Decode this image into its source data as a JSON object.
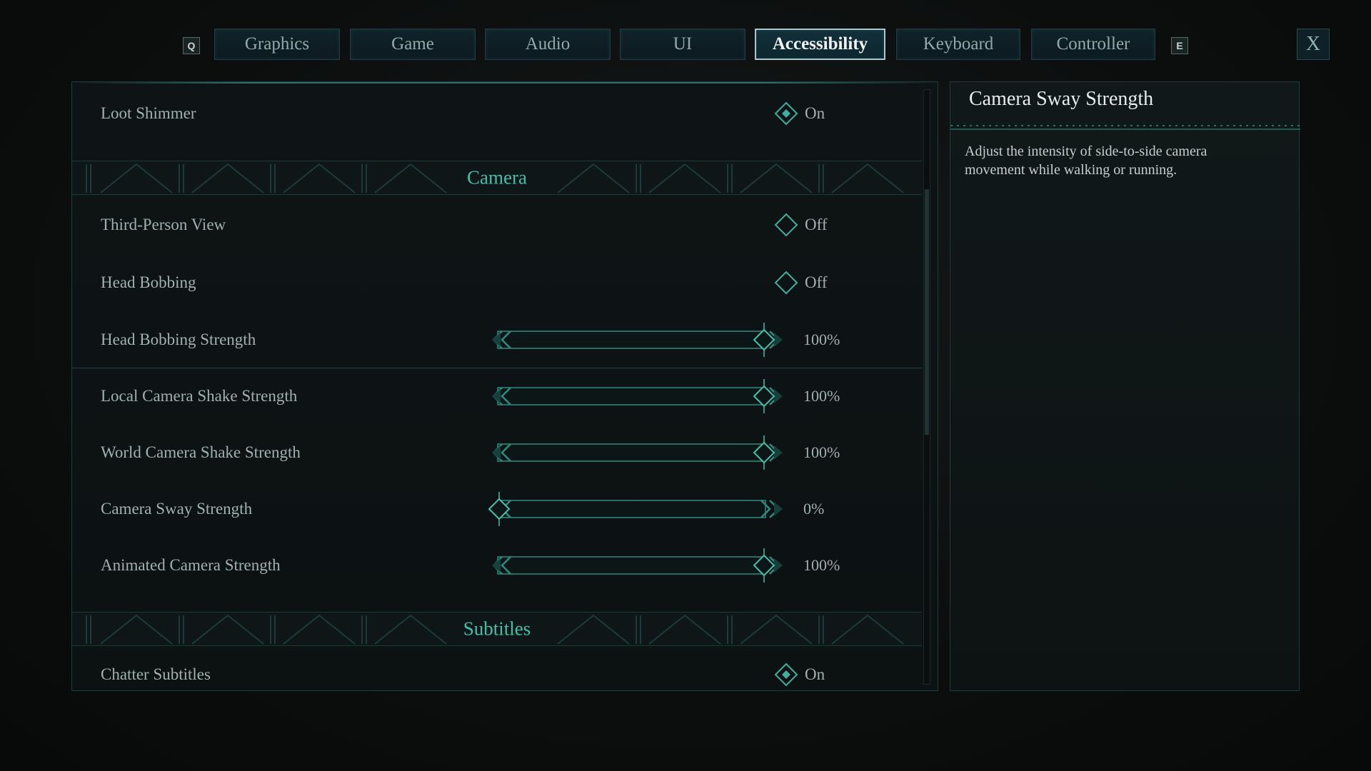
{
  "tabs": {
    "prev_key": "Q",
    "next_key": "E",
    "items": [
      {
        "label": "Graphics"
      },
      {
        "label": "Game"
      },
      {
        "label": "Audio"
      },
      {
        "label": "UI"
      },
      {
        "label": "Accessibility",
        "active": true
      },
      {
        "label": "Keyboard"
      },
      {
        "label": "Controller"
      }
    ],
    "close_label": "X"
  },
  "settings": {
    "loot_shimmer": {
      "label": "Loot Shimmer",
      "value": "On"
    },
    "camera_section": "Camera",
    "third_person": {
      "label": "Third-Person View",
      "value": "Off"
    },
    "head_bobbing": {
      "label": "Head Bobbing",
      "value": "Off"
    },
    "head_bobbing_strength": {
      "label": "Head Bobbing Strength",
      "value": "100%",
      "level": 1.0
    },
    "local_shake": {
      "label": "Local Camera Shake Strength",
      "value": "100%",
      "level": 1.0
    },
    "world_shake": {
      "label": "World Camera Shake Strength",
      "value": "100%",
      "level": 1.0
    },
    "camera_sway": {
      "label": "Camera Sway Strength",
      "value": "0%",
      "level": 0.0
    },
    "animated_camera": {
      "label": "Animated Camera Strength",
      "value": "100%",
      "level": 1.0
    },
    "subtitles_section": "Subtitles",
    "chatter_subtitles": {
      "label": "Chatter Subtitles",
      "value": "On"
    }
  },
  "description": {
    "title": "Camera Sway Strength",
    "text": "Adjust the intensity of side-to-side camera movement while walking or running."
  },
  "colors": {
    "accent": "#3fc1ab",
    "slider_line": "#2f8a80",
    "text": "#9fb2b0"
  }
}
